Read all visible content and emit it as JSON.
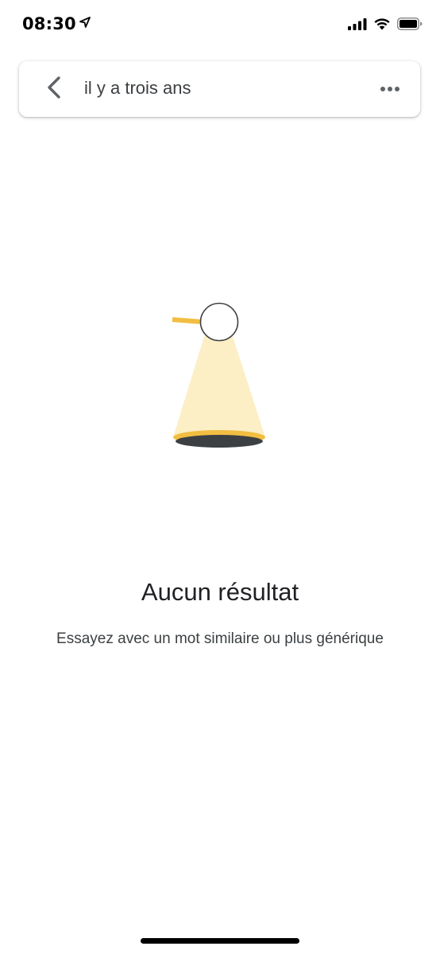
{
  "status_bar": {
    "time": "08:30",
    "location_icon": "location-arrow-icon",
    "signal_icon": "cellular-signal-icon",
    "wifi_icon": "wifi-icon",
    "battery_icon": "battery-icon"
  },
  "search_bar": {
    "back_icon": "chevron-left-icon",
    "query": "il y a trois ans",
    "more_icon": "more-horizontal-icon"
  },
  "empty_state": {
    "illustration": "spotlight-magnifier-illustration",
    "title": "Aucun résultat",
    "subtitle": "Essayez avec un mot similaire ou plus générique"
  },
  "colors": {
    "accent_yellow": "#F2BE42",
    "light_beam": "#FCEFC6",
    "hole": "#3C4043",
    "text_primary": "#202124",
    "text_secondary": "#3C4043",
    "icon_gray": "#5F6368"
  }
}
